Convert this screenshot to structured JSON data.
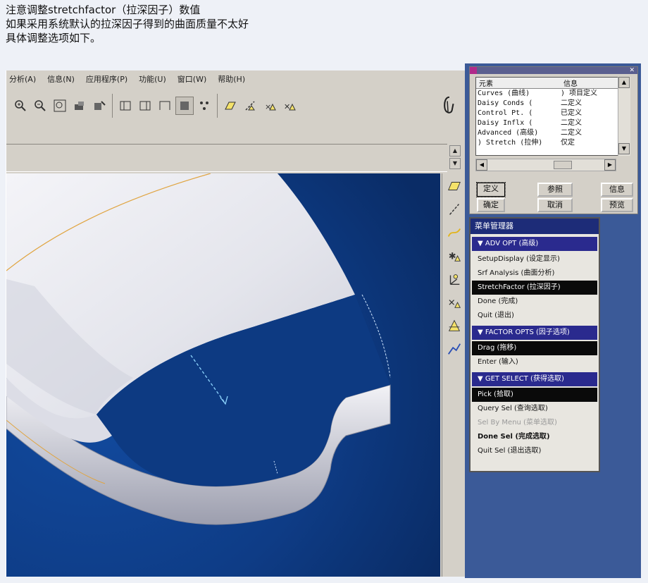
{
  "intro": {
    "line1": "注意调整stretchfactor（拉深因子）数值",
    "line2": "如果采用系统默认的拉深因子得到的曲面质量不太好",
    "line3": "具体调整选项如下。"
  },
  "menubar": [
    "分析(A)",
    "信息(N)",
    "应用程序(P)",
    "功能(U)",
    "窗口(W)",
    "帮助(H)"
  ],
  "toolbar_icons": [
    "zoom-in",
    "zoom-out",
    "zoom-window",
    "repaint",
    "orient",
    "view-1",
    "view-2",
    "view-3",
    "shade",
    "datum-toggle",
    "plane",
    "axis",
    "point",
    "csys"
  ],
  "right_icons": [
    "datum-plane",
    "datum-axis",
    "datum-curve",
    "datum-point",
    "csys-tool",
    "analysis-tool",
    "feature-tool",
    "sketch-tool"
  ],
  "lister": {
    "col_element": "元素",
    "col_info": "信息",
    "rows": [
      {
        "element": "Curves (曲线)",
        "info": ") 项目定义"
      },
      {
        "element": "Daisy Conds (",
        "info": "二定义"
      },
      {
        "element": "Control Pt. (",
        "info": "已定义"
      },
      {
        "element": "Daisy Inflx (",
        "info": "二定义"
      },
      {
        "element": "Advanced (高级)",
        "info": "二定义"
      },
      {
        "element": ") Stretch (拉伸)",
        "info": "仅定"
      }
    ],
    "buttons": {
      "define": "定义",
      "reference": "参照",
      "info": "信息",
      "ok": "确定",
      "cancel": "取消",
      "preview": "预览"
    }
  },
  "menu_manager": {
    "title": "菜单管理器",
    "sections": [
      {
        "header": "▼ ADV OPT (高级)",
        "items": [
          {
            "label": "SetupDisplay (设定显示)",
            "state": "normal"
          },
          {
            "label": "Srf Analysis (曲面分析)",
            "state": "normal"
          },
          {
            "label": "StretchFactor (拉深因子)",
            "state": "selected"
          },
          {
            "label": "Done (完成)",
            "state": "normal"
          },
          {
            "label": "Quit (退出)",
            "state": "normal"
          }
        ]
      },
      {
        "header": "▼ FACTOR OPTS (因子选项)",
        "items": [
          {
            "label": "Drag (拖移)",
            "state": "selected"
          },
          {
            "label": "Enter (输入)",
            "state": "normal"
          }
        ]
      },
      {
        "header": "▼ GET SELECT (获得选取)",
        "items": [
          {
            "label": "Pick (拾取)",
            "state": "selected"
          },
          {
            "label": "Query Sel (查询选取)",
            "state": "normal"
          },
          {
            "label": "Sel By Menu (菜单选取)",
            "state": "dim"
          },
          {
            "label": "Done Sel (完成选取)",
            "state": "bold"
          },
          {
            "label": "Quit Sel (退出选取)",
            "state": "normal"
          }
        ]
      }
    ]
  },
  "colors": {
    "viewport_bg": "#0e3c86",
    "surface": "#e7e8ef",
    "blue_panel": "#3b5a98",
    "menu_title": "#1d2c78",
    "edge_curve": "#e0a440"
  }
}
